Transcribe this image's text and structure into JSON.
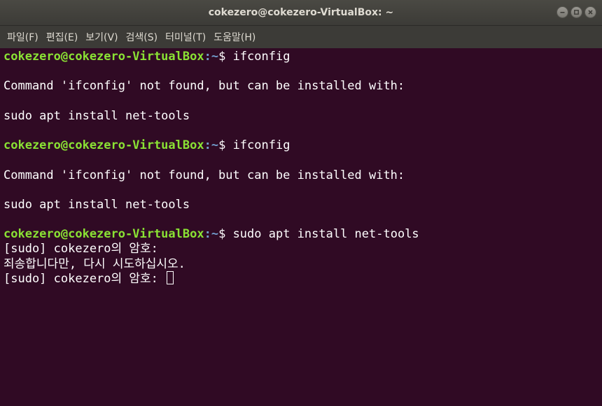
{
  "window": {
    "title": "cokezero@cokezero-VirtualBox: ~",
    "controls": [
      "minimize-icon",
      "maximize-icon",
      "close-icon"
    ]
  },
  "menu": [
    "파일(F)",
    "편집(E)",
    "보기(V)",
    "검색(S)",
    "터미널(T)",
    "도움말(H)"
  ],
  "terminal": {
    "lines": [
      {
        "type": "prompt",
        "user": "cokezero@cokezero-VirtualBox",
        "path": "~",
        "symbol": "$ ",
        "command": "ifconfig"
      },
      {
        "type": "blank"
      },
      {
        "type": "output",
        "text": "Command 'ifconfig' not found, but can be installed with:"
      },
      {
        "type": "blank"
      },
      {
        "type": "output",
        "text": "sudo apt install net-tools"
      },
      {
        "type": "blank"
      },
      {
        "type": "prompt",
        "user": "cokezero@cokezero-VirtualBox",
        "path": "~",
        "symbol": "$ ",
        "command": "ifconfig"
      },
      {
        "type": "blank"
      },
      {
        "type": "output",
        "text": "Command 'ifconfig' not found, but can be installed with:"
      },
      {
        "type": "blank"
      },
      {
        "type": "output",
        "text": "sudo apt install net-tools"
      },
      {
        "type": "blank"
      },
      {
        "type": "prompt",
        "user": "cokezero@cokezero-VirtualBox",
        "path": "~",
        "symbol": "$ ",
        "command": "sudo apt install net-tools"
      },
      {
        "type": "output",
        "text": "[sudo] cokezero의 암호:"
      },
      {
        "type": "output",
        "text": "죄송합니다만, 다시 시도하십시오."
      },
      {
        "type": "input",
        "text": "[sudo] cokezero의 암호: "
      }
    ]
  },
  "colors": {
    "background": "#300a24",
    "prompt_user": "#8ae234",
    "prompt_path": "#729fcf",
    "text": "#ffffff"
  }
}
